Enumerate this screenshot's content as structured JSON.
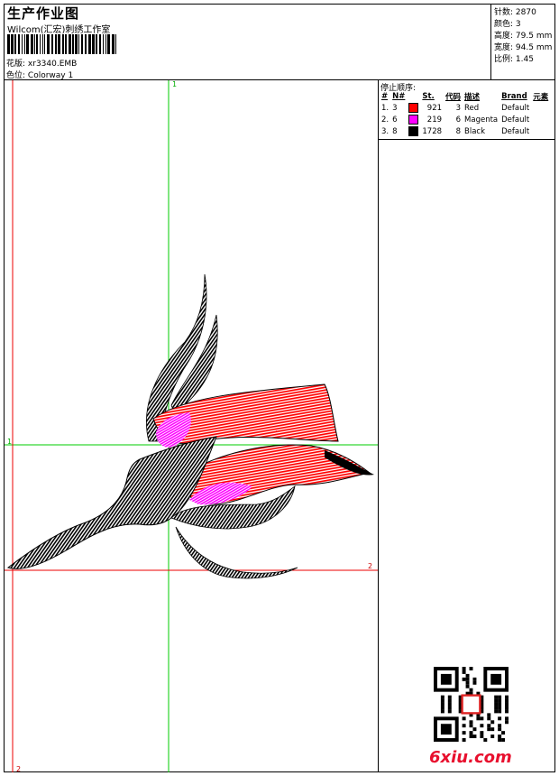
{
  "header": {
    "title": "生产作业图",
    "company": "Wilcom(汇宏)刺绣工作室",
    "design_label": "花版:",
    "design_value": "xr3340.EMB",
    "colorway_label": "色位:",
    "colorway_value": "Colorway 1"
  },
  "stats": [
    {
      "label": "针数:",
      "value": "2870"
    },
    {
      "label": "颜色:",
      "value": "3"
    },
    {
      "label": "高度:",
      "value": "79.5 mm"
    },
    {
      "label": "宽度:",
      "value": "94.5 mm"
    },
    {
      "label": "比例:",
      "value": "1.45"
    }
  ],
  "sequence": {
    "title": "停止顺序:",
    "headers": [
      "#",
      "N#",
      "",
      "St.",
      "代码",
      "描述",
      "Brand",
      "元素"
    ],
    "rows": [
      {
        "idx": "1.",
        "n": "3",
        "color": "#ff0000",
        "st": "921",
        "code": "3",
        "desc": "Red",
        "brand": "Default"
      },
      {
        "idx": "2.",
        "n": "6",
        "color": "#ff00ff",
        "st": "219",
        "code": "6",
        "desc": "Magenta",
        "brand": "Default"
      },
      {
        "idx": "3.",
        "n": "8",
        "color": "#000000",
        "st": "1728",
        "code": "8",
        "desc": "Black",
        "brand": "Default"
      }
    ]
  },
  "axes": {
    "green_top": "1",
    "green_left": "1",
    "red_right": "2",
    "red_bottom": "2"
  },
  "colors": {
    "red_thread": "#ff0000",
    "magenta_thread": "#ff00ff",
    "black_thread": "#000000",
    "green_axis": "#00cc00",
    "red_axis": "#ee0000"
  },
  "watermark": "6xiu.com"
}
